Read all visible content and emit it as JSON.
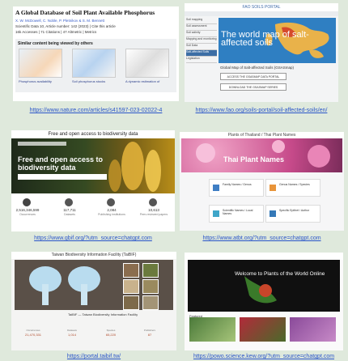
{
  "panels": [
    {
      "title": "A Global Database of Soil Plant Available Phosphorus",
      "authors": "X. W. McDowell, C. Noble, P. Pletnikov & S. M. Bennett",
      "meta": "Scientific Data 10, Article number: 142 (2023) | Cite this article",
      "stats": "16k Accesses | 71 Citations | 47 Altmetric | Metrics",
      "similar_header": "Similar content being viewed by others",
      "thumbs": [
        "Phosphorus availability",
        "Soil phosphorus stocks",
        "A dynamic estimation of"
      ],
      "url": "https://www.nature.com/articles/s41597-023-02022-4"
    },
    {
      "portal": "FAO SOILS PORTAL",
      "side_items": [
        "Soil mapping",
        "Soil assessment",
        "Soil salinity",
        "Mapping and monitoring",
        "Soil Data",
        "Salt-affected Soils",
        "Legislation"
      ],
      "map_title": "The world map of salt-affected soils",
      "map_heading": "Global Map of Salt-affected Soils (GSASmap)",
      "btn1": "ACCESS THE GSASMAP DATA PORTAL",
      "btn2": "DOWNLOAD THE GSASMAP SERIES",
      "url": "https://www.fao.org/soils-portal/soil-affected-soils/en/"
    },
    {
      "header": "Free and open access to biodiversity data",
      "hero_title": "Free and open access to biodiversity data",
      "stats": [
        {
          "v": "2,516,346,599",
          "l": "Occurrences"
        },
        {
          "v": "117,711",
          "l": "Datasets"
        },
        {
          "v": "2,084",
          "l": "Publishing institutions"
        },
        {
          "v": "10,613",
          "l": "Peer-reviewed papers"
        }
      ],
      "url": "https://www.gbif.org/?utm_source=chatgpt.com"
    },
    {
      "header": "Plants of Thailand / Thai Plant Names",
      "hero_title": "Thai Plant Names",
      "cards": [
        "Family Names / Genus",
        "Genus Names / Species",
        "Scientific Names / Local Names",
        "Specific Epithet / Author"
      ],
      "url": "https://www.atbt.org/?utm_source=chatgpt.com"
    },
    {
      "header": "Taiwan Biodiversity Information Facility (TaiBIF)",
      "footer_text": "TaiBIF — Taiwan Biodiversity Information Facility",
      "stats": [
        {
          "l": "Occurrences",
          "v": "21,470,331"
        },
        {
          "l": "Datasets",
          "v": "1,014"
        },
        {
          "l": "Species",
          "v": "65,220"
        },
        {
          "l": "Publishers",
          "v": "87"
        }
      ],
      "url": "https://portal.taibif.tw/"
    },
    {
      "hero_title": "Welcome to Plants of the World Online",
      "label": "Featured",
      "url": "https://powo.science.kew.org/?utm_source=chatgpt.com"
    }
  ]
}
